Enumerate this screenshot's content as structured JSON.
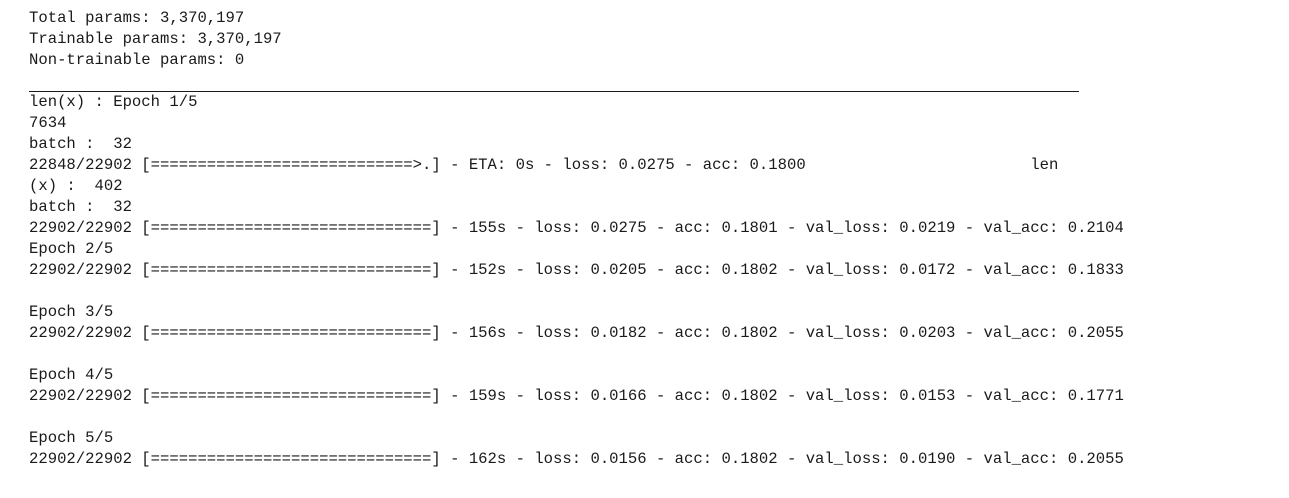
{
  "summary": {
    "total_params": "Total params: 3,370,197",
    "trainable_params": "Trainable params: 3,370,197",
    "non_trainable_params": "Non-trainable params: 0"
  },
  "log": {
    "line_01": "len(x) : Epoch 1/5",
    "line_02": "7634",
    "line_03": "batch :  32",
    "line_04": "22848/22902 [============================>.] - ETA: 0s - loss: 0.0275 - acc: 0.1800                        len",
    "line_05": "(x) :  402",
    "line_06": "batch :  32",
    "line_07": "22902/22902 [==============================] - 155s - loss: 0.0275 - acc: 0.1801 - val_loss: 0.0219 - val_acc: 0.2104",
    "line_08": "Epoch 2/5",
    "line_09": "22902/22902 [==============================] - 152s - loss: 0.0205 - acc: 0.1802 - val_loss: 0.0172 - val_acc: 0.1833",
    "line_10": "Epoch 3/5",
    "line_11": "22902/22902 [==============================] - 156s - loss: 0.0182 - acc: 0.1802 - val_loss: 0.0203 - val_acc: 0.2055",
    "line_12": "Epoch 4/5",
    "line_13": "22902/22902 [==============================] - 159s - loss: 0.0166 - acc: 0.1802 - val_loss: 0.0153 - val_acc: 0.1771",
    "line_14": "Epoch 5/5",
    "line_15": "22902/22902 [==============================] - 162s - loss: 0.0156 - acc: 0.1802 - val_loss: 0.0190 - val_acc: 0.2055"
  }
}
